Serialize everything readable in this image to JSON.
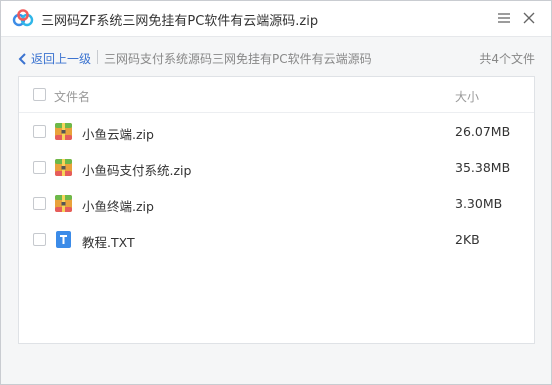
{
  "window": {
    "title": "三网码ZF系统三网免挂有PC软件有云端源码.zip"
  },
  "nav": {
    "back_label": "返回上一级",
    "breadcrumb": "三网码支付系统源码三网免挂有PC软件有云端源码",
    "file_count": "共4个文件"
  },
  "table": {
    "columns": {
      "name": "文件名",
      "size": "大小"
    },
    "rows": [
      {
        "name": "小鱼云端.zip",
        "size": "26.07MB",
        "icon": "zip-archive-icon"
      },
      {
        "name": "小鱼码支付系统.zip",
        "size": "35.38MB",
        "icon": "zip-archive-icon"
      },
      {
        "name": "小鱼终端.zip",
        "size": "3.30MB",
        "icon": "zip-archive-icon"
      },
      {
        "name": "教程.TXT",
        "size": "2KB",
        "icon": "text-file-icon"
      }
    ]
  },
  "colors": {
    "accent": "#3b73d0",
    "zip_icon": "#e9a23b",
    "txt_icon": "#3b8be8"
  }
}
